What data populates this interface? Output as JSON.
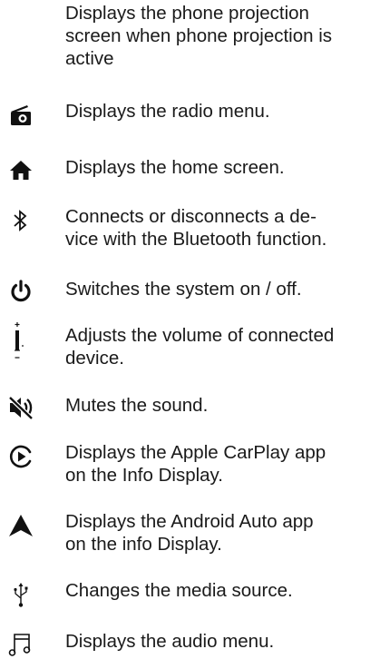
{
  "entries": [
    {
      "icon": "phone-projection-icon",
      "lines": [
        "Displays the phone projection",
        "screen when phone projection is",
        "active"
      ]
    },
    {
      "icon": "radio-icon",
      "lines": [
        "Displays the radio menu."
      ]
    },
    {
      "icon": "home-icon",
      "lines": [
        "Displays the home screen."
      ]
    },
    {
      "icon": "bluetooth-icon",
      "lines": [
        "Connects or disconnects a de-",
        "vice with the Bluetooth function."
      ]
    },
    {
      "icon": "power-icon",
      "lines": [
        "Switches the system on / off."
      ]
    },
    {
      "icon": "volume-knob-icon",
      "lines": [
        "Adjusts the volume of connected",
        "device."
      ]
    },
    {
      "icon": "mute-icon",
      "lines": [
        "Mutes the sound."
      ]
    },
    {
      "icon": "carplay-icon",
      "lines": [
        "Displays the Apple CarPlay app",
        "on the Info Display."
      ]
    },
    {
      "icon": "android-auto-icon",
      "lines": [
        "Displays the Android Auto app",
        "on the info Display."
      ]
    },
    {
      "icon": "usb-icon",
      "lines": [
        "Changes the media source."
      ]
    },
    {
      "icon": "audio-icon",
      "lines": [
        "Displays the audio menu."
      ]
    }
  ],
  "colors": {
    "text": "#1a1a1a",
    "icon": "#111111"
  }
}
